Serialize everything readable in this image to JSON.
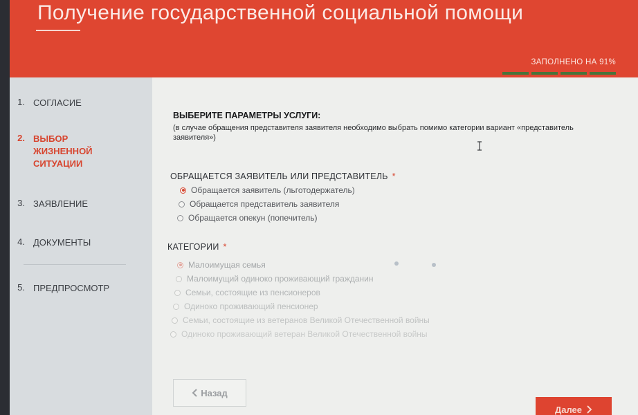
{
  "header": {
    "title": "Получение государственной социальной помощи",
    "progress_label": "ЗАПОЛНЕНО НА 91%",
    "progress_segments": 4
  },
  "sidebar": {
    "steps": [
      {
        "num": "1.",
        "label": "СОГЛАСИЕ",
        "active": false
      },
      {
        "num": "2.",
        "label": "ВЫБОР ЖИЗНЕННОЙ СИТУАЦИИ",
        "active": true
      },
      {
        "num": "3.",
        "label": "ЗАЯВЛЕНИЕ",
        "active": false
      },
      {
        "num": "4.",
        "label": "ДОКУМЕНТЫ",
        "active": false
      },
      {
        "num": "5.",
        "label": "ПРЕДПРОСМОТР",
        "active": false
      }
    ]
  },
  "main": {
    "section_title": "ВЫБЕРИТЕ ПАРАМЕТРЫ УСЛУГИ:",
    "section_note": "(в случае обращения представителя заявителя необходимо выбрать помимо категории вариант «представитель заявителя»)",
    "applicant": {
      "label": "ОБРАЩАЕТСЯ ЗАЯВИТЕЛЬ ИЛИ ПРЕДСТАВИТЕЛЬ",
      "required_mark": "*",
      "options": [
        {
          "label": "Обращается заявитель (льготодержатель)",
          "selected": true
        },
        {
          "label": "Обращается представитель заявителя",
          "selected": false
        },
        {
          "label": "Обращается опекун (попечитель)",
          "selected": false
        }
      ]
    },
    "categories": {
      "label": "КАТЕГОРИИ",
      "required_mark": "*",
      "options": [
        {
          "label": "Малоимущая семья",
          "selected": true
        },
        {
          "label": "Малоимущий одиноко проживающий гражданин",
          "selected": false
        },
        {
          "label": "Семьи, состоящие из пенсионеров",
          "selected": false
        },
        {
          "label": "Одиноко проживающий пенсионер",
          "selected": false
        },
        {
          "label": "Семьи, состоящие из ветеранов Великой Отечественной войны",
          "selected": false
        },
        {
          "label": "Одиноко проживающий ветеран Великой Отечественной войны",
          "selected": false
        }
      ]
    }
  },
  "footer": {
    "back_label": "Назад",
    "next_label": "Далее"
  },
  "icons": {
    "back": "chevron-left-icon",
    "next": "chevron-right-icon",
    "cursor": "text-cursor-icon"
  },
  "colors": {
    "accent": "#df4631",
    "progress": "#48733a",
    "sidebar_bg": "#d8dcdf",
    "content_bg": "#eeefed"
  }
}
